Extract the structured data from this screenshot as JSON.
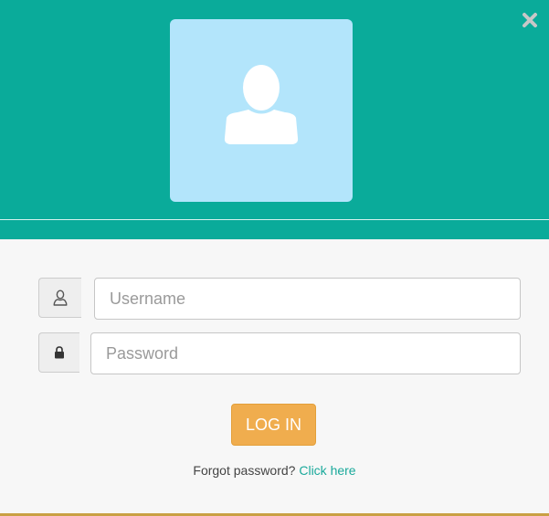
{
  "header": {
    "background_color": "#0aab9a",
    "close_icon": "close-icon",
    "avatar_icon": "user-icon",
    "avatar_bg_color": "#b3e5fb"
  },
  "form": {
    "username": {
      "icon": "user-outline-icon",
      "value": "",
      "placeholder": "Username"
    },
    "password": {
      "icon": "lock-icon",
      "value": "",
      "placeholder": "Password"
    },
    "login_button": {
      "label": "LOG IN",
      "color": "#f0ad4e"
    },
    "forgot": {
      "text": "Forgot password?",
      "link_label": "Click here",
      "link_color": "#1aa99b"
    }
  }
}
